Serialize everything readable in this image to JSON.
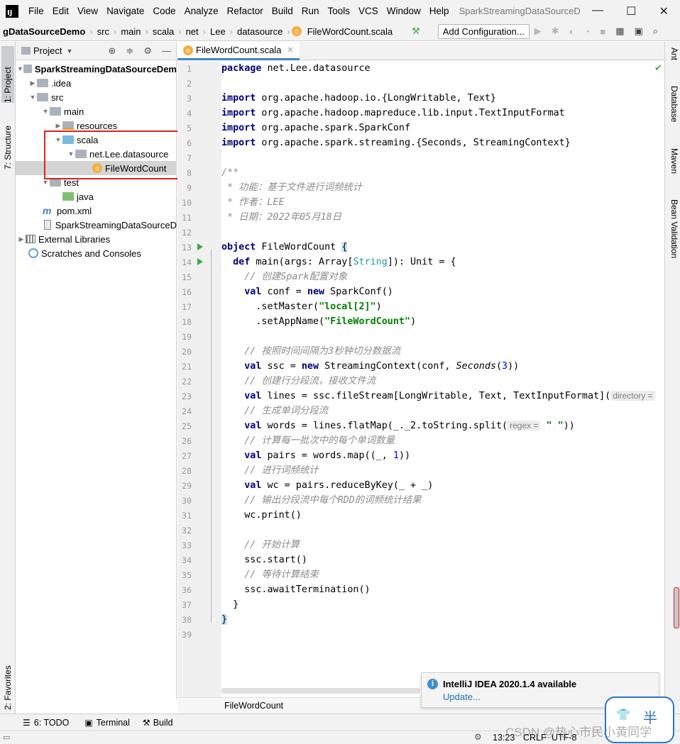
{
  "window": {
    "title": "SparkStreamingDataSourceDem",
    "minimize": "—",
    "maximize": "☐",
    "close": "✕"
  },
  "menu": [
    "File",
    "Edit",
    "View",
    "Navigate",
    "Code",
    "Analyze",
    "Refactor",
    "Build",
    "Run",
    "Tools",
    "VCS",
    "Window",
    "Help"
  ],
  "breadcrumb": [
    "gDataSourceDemo",
    "src",
    "main",
    "scala",
    "net",
    "Lee",
    "datasource",
    "FileWordCount.scala"
  ],
  "toolbar": {
    "add_configuration": "Add Configuration..."
  },
  "left_tabs": {
    "project": "1: Project",
    "structure": "7: Structure",
    "favorites": "2: Favorites"
  },
  "right_tabs": {
    "ant": "Ant",
    "database": "Database",
    "maven": "Maven",
    "bean_validation": "Bean Validation"
  },
  "project_panel": {
    "title": "Project",
    "tree": [
      {
        "label": "SparkStreamingDataSourceDem",
        "bold": true
      },
      {
        "label": ".idea"
      },
      {
        "label": "src"
      },
      {
        "label": "main"
      },
      {
        "label": "resources"
      },
      {
        "label": "scala"
      },
      {
        "label": "net.Lee.datasource"
      },
      {
        "label": "FileWordCount"
      },
      {
        "label": "test"
      },
      {
        "label": "java"
      },
      {
        "label": "pom.xml"
      },
      {
        "label": "SparkStreamingDataSourceD"
      },
      {
        "label": "External Libraries"
      },
      {
        "label": "Scratches and Consoles"
      }
    ]
  },
  "editor": {
    "tab_label": "FileWordCount.scala",
    "footer_breadcrumb": "FileWordCount",
    "line_numbers": [
      "1",
      "2",
      "3",
      "4",
      "5",
      "6",
      "7",
      "8",
      "9",
      "10",
      "11",
      "12",
      "13",
      "14",
      "15",
      "16",
      "17",
      "18",
      "19",
      "20",
      "21",
      "22",
      "23",
      "24",
      "25",
      "26",
      "27",
      "28",
      "29",
      "30",
      "31",
      "32",
      "33",
      "34",
      "35",
      "36",
      "37",
      "38",
      "39"
    ],
    "code": {
      "l1_kw": "package",
      "l1_rest": " net.Lee.datasource",
      "l3_kw": "import",
      "l3_rest": " org.apache.hadoop.io.{LongWritable, Text}",
      "l4_kw": "import",
      "l4_rest": " org.apache.hadoop.mapreduce.lib.input.TextInputFormat",
      "l5_kw": "import",
      "l5_rest": " org.apache.spark.SparkConf",
      "l6_kw": "import",
      "l6_rest": " org.apache.spark.streaming.{Seconds, StreamingContext}",
      "l8": "/**",
      "l9": " * 功能：基于文件进行词频统计",
      "l10": " * 作者：LEE",
      "l11": " * 日期：2022年05月18日",
      "l13_kw": "object",
      "l13_rest": " FileWordCount ",
      "l13_brace": "{",
      "l14_indent": "  ",
      "l14_kw": "def",
      "l14_a": " main(args: Array[",
      "l14_ty": "String",
      "l14_b": "]): Unit = {",
      "l15": "    // 创建Spark配置对象",
      "l16_indent": "    ",
      "l16_kw1": "val",
      "l16_a": " conf = ",
      "l16_kw2": "new",
      "l16_b": " SparkConf()",
      "l17_a": "      .setMaster(",
      "l17_str": "\"local[2]\"",
      "l17_b": ")",
      "l18_a": "      .setAppName(",
      "l18_str": "\"FileWordCount\"",
      "l18_b": ")",
      "l20": "    // 按照时间间隔为3秒钟切分数据流",
      "l21_indent": "    ",
      "l21_kw1": "val",
      "l21_a": " ssc = ",
      "l21_kw2": "new",
      "l21_b": " StreamingContext(conf, ",
      "l21_it": "Seconds",
      "l21_c": "(",
      "l21_num": "3",
      "l21_d": "))",
      "l22": "    // 创建行分段流，接收文件流",
      "l23_indent": "    ",
      "l23_kw": "val",
      "l23_a": " lines = ssc.fileStream[LongWritable, Text, TextInputFormat](",
      "l23_hint": "directory =",
      "l24": "    // 生成单词分段流",
      "l25_indent": "    ",
      "l25_kw": "val",
      "l25_a": " words = lines.flatMap(_._2.toString.split(",
      "l25_hint": "regex =",
      "l25_str": " \" \"",
      "l25_b": "))",
      "l26": "    // 计算每一批次中的每个单词数量",
      "l27_indent": "    ",
      "l27_kw": "val",
      "l27_a": " pairs = words.map((_, ",
      "l27_num": "1",
      "l27_b": "))",
      "l28": "    // 进行词频统计",
      "l29_indent": "    ",
      "l29_kw": "val",
      "l29_a": " wc = pairs.reduceByKey(_ + _)",
      "l30": "    // 输出分段流中每个RDD的词频统计结果",
      "l31": "    wc.print()",
      "l33": "    // 开始计算",
      "l34": "    ssc.start()",
      "l35": "    // 等待计算结束",
      "l36": "    ssc.awaitTermination()",
      "l37": "  }",
      "l38": "}"
    }
  },
  "notification": {
    "title": "IntelliJ IDEA 2020.1.4 available",
    "link": "Update..."
  },
  "bottom_tabs": {
    "todo": "6: TODO",
    "terminal": "Terminal",
    "build": "Build"
  },
  "status": {
    "position": "13:23",
    "line_sep": "CRLF",
    "encoding": "UTF-8"
  },
  "watermark": "CSDN @热心市民小黄同学",
  "colors": {
    "keyword": "#000080",
    "string": "#008000",
    "comment": "#8c8c8c",
    "number": "#0000ff",
    "accent": "#4083c9",
    "highlight_box": "#e02020"
  }
}
